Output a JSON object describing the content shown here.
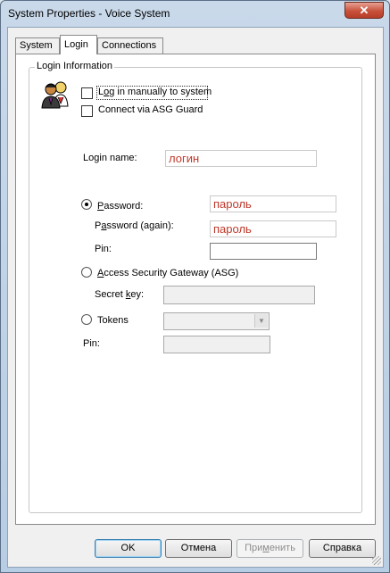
{
  "window": {
    "title": "System Properties - Voice System",
    "close_glyph": "✕"
  },
  "tabs": [
    {
      "label": "System",
      "active": false
    },
    {
      "label": "Login",
      "active": true
    },
    {
      "label": "Connections",
      "active": false
    }
  ],
  "group": {
    "title": "Login Information",
    "icon": "users-icon"
  },
  "options": {
    "manual_login_pre": "L",
    "manual_login_u": "o",
    "manual_login_post": "g in manually to system",
    "manual_login_checked": false,
    "asg_guard_label": "Connect via ASG Guard",
    "asg_guard_checked": false
  },
  "login_name": {
    "label_pre": "Lo",
    "label_u": "g",
    "label_post": "in name:",
    "value": "логин"
  },
  "password": {
    "radio_pre": "",
    "radio_u": "P",
    "radio_post": "assword:",
    "radio_checked": true,
    "value": "пароль",
    "again_pre": "P",
    "again_u": "a",
    "again_post": "ssword (again):",
    "again_value": "пароль",
    "pin_label": "Pin:",
    "pin_value": ""
  },
  "asg": {
    "radio_pre": "",
    "radio_u": "A",
    "radio_post": "ccess Security Gateway (ASG)",
    "radio_checked": false,
    "secret_pre": "Secret ",
    "secret_u": "k",
    "secret_post": "ey:",
    "secret_value": ""
  },
  "tokens": {
    "radio_label": "Tokens",
    "radio_checked": false,
    "select_value": "",
    "pin_label": "Pin:",
    "pin_value": ""
  },
  "buttons": {
    "ok": "OK",
    "cancel": "Отмена",
    "apply_pre": "При",
    "apply_u": "м",
    "apply_post": "енить",
    "help": "Справка"
  },
  "colors": {
    "accent_text": "#c0392b",
    "close_button": "#c8513c"
  }
}
